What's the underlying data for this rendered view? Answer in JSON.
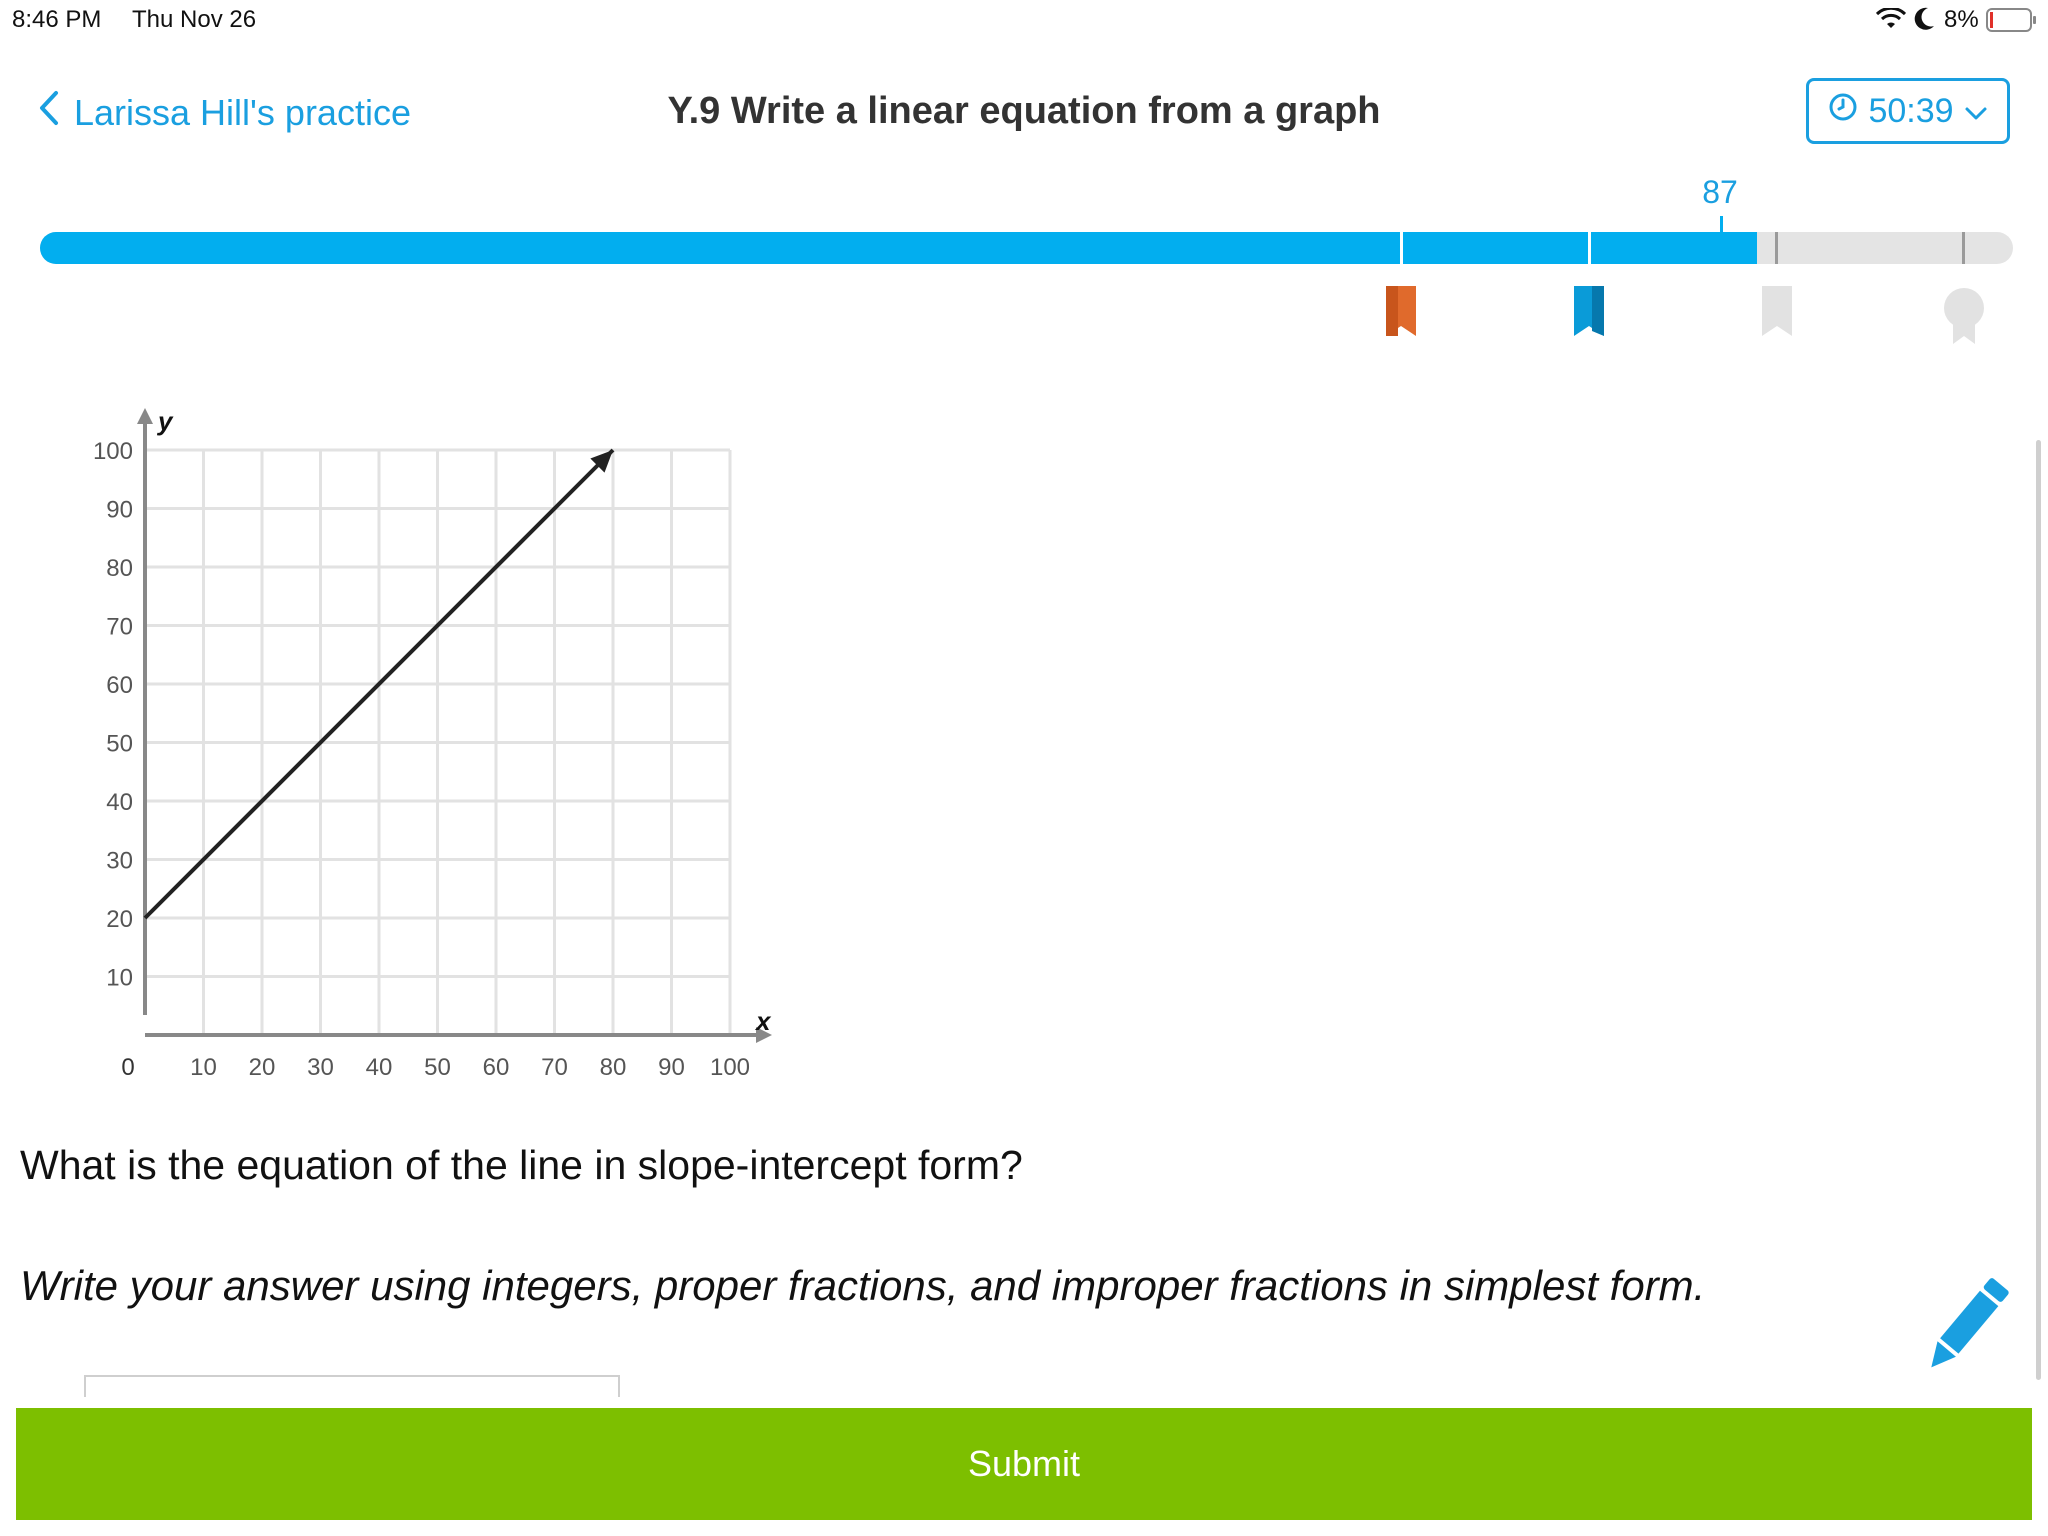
{
  "status_bar": {
    "time": "8:46 PM",
    "date": "Thu Nov 26",
    "battery": "8%",
    "icons": [
      "wifi-icon",
      "moon-icon",
      "battery-icon"
    ]
  },
  "header": {
    "back_label": "Larissa Hill's practice",
    "title": "Y.9 Write a linear equation from a graph",
    "timer": "50:39"
  },
  "progress": {
    "score": "87",
    "value": 87,
    "max": 100,
    "fill_color": "#02aeef",
    "milestones": [
      {
        "name": "orange-ribbon-icon",
        "color": "#e06a2c",
        "earned": true
      },
      {
        "name": "blue-ribbon-icon",
        "color": "#0a9bd8",
        "earned": true
      },
      {
        "name": "gray-ribbon-icon",
        "color": "#e2e2e2",
        "earned": false
      },
      {
        "name": "award-medal-icon",
        "color": "#e2e2e2",
        "earned": false
      }
    ]
  },
  "chart_data": {
    "type": "line",
    "xlabel": "x",
    "ylabel": "y",
    "xlim": [
      0,
      100
    ],
    "ylim": [
      0,
      100
    ],
    "x_ticks": [
      "10",
      "20",
      "30",
      "40",
      "50",
      "60",
      "70",
      "80",
      "90",
      "100"
    ],
    "y_ticks": [
      "10",
      "20",
      "30",
      "40",
      "50",
      "60",
      "70",
      "80",
      "90",
      "100"
    ],
    "origin_label": "0",
    "grid": true,
    "series": [
      {
        "points": [
          [
            0,
            20
          ],
          [
            80,
            100
          ]
        ],
        "arrow_end": true,
        "color": "#222222"
      }
    ]
  },
  "question": {
    "prompt": "What is the equation of the line in slope-intercept form?",
    "instructions": "Write your answer using integers, proper fractions, and improper fractions in simplest form.",
    "answer_value": ""
  },
  "submit_label": "Submit",
  "colors": {
    "accent": "#1a9fe0",
    "submit": "#7dbf00",
    "pencil": "#1a9fe0"
  }
}
